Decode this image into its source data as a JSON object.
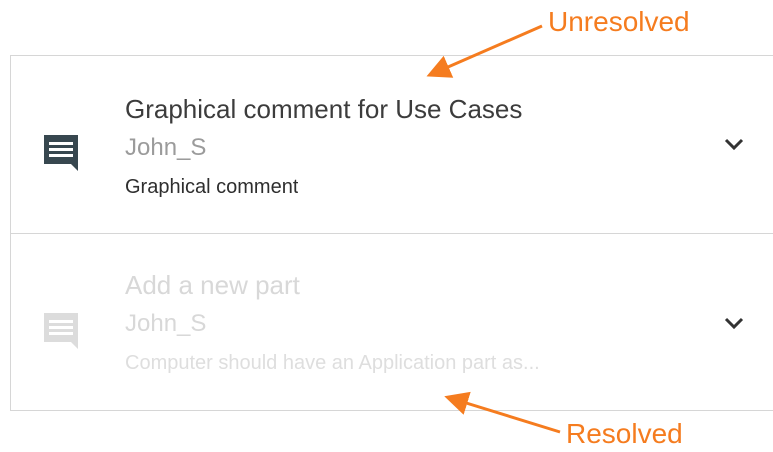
{
  "annotations": {
    "unresolved": "Unresolved",
    "resolved": "Resolved",
    "color": "#f57c1f"
  },
  "comments": [
    {
      "title": "Graphical comment for Use Cases",
      "author": "John_S",
      "text": "Graphical comment",
      "icon": "comment-icon",
      "state": "unresolved",
      "expand_icon": "chevron-down-icon"
    },
    {
      "title": "Add a new part",
      "author": "John_S",
      "text": "Computer should have an Application part as...",
      "icon": "comment-icon",
      "state": "resolved",
      "expand_icon": "chevron-down-icon"
    }
  ]
}
